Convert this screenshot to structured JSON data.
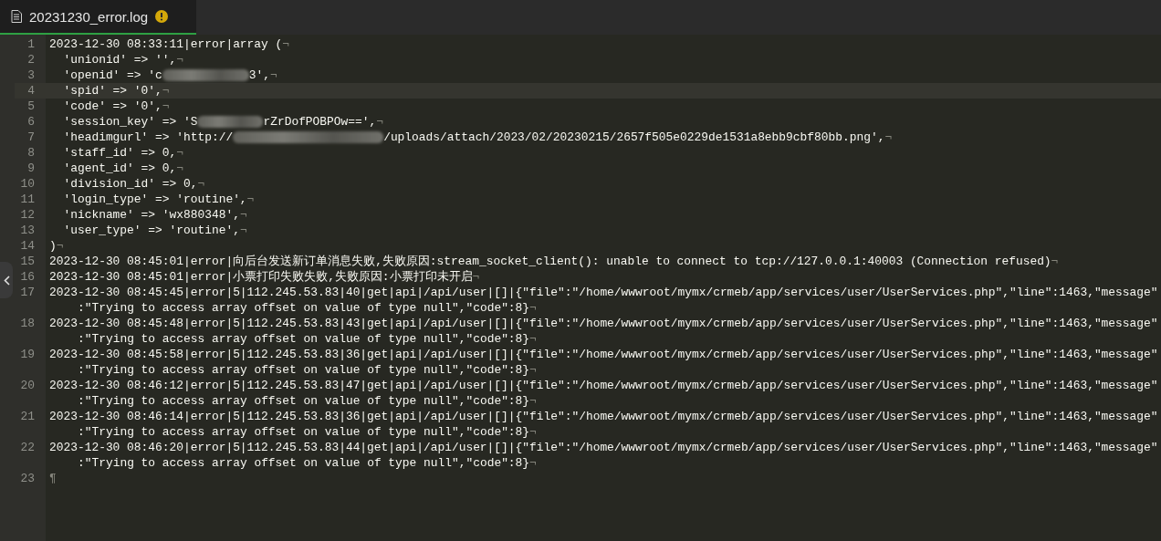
{
  "tabs": [
    {
      "label": "20231230_error.log",
      "selected": true,
      "warning": true
    }
  ],
  "editor": {
    "lines": [
      {
        "number": "1",
        "current": false,
        "segments": [
          {
            "kind": "text",
            "text": "2023-12-30 08:33:11|error|array ("
          }
        ],
        "eol": "¬"
      },
      {
        "number": "2",
        "current": false,
        "segments": [
          {
            "kind": "text",
            "text": "  'unionid' => '',"
          }
        ],
        "eol": "¬"
      },
      {
        "number": "3",
        "current": false,
        "segments": [
          {
            "kind": "text",
            "text": "  'openid' => 'c"
          },
          {
            "kind": "blur"
          },
          {
            "kind": "text",
            "text": "3',"
          }
        ],
        "eol": "¬"
      },
      {
        "number": "4",
        "current": true,
        "segments": [
          {
            "kind": "text",
            "text": "  'spid' => '0',"
          }
        ],
        "eol": "¬"
      },
      {
        "number": "5",
        "current": false,
        "segments": [
          {
            "kind": "text",
            "text": "  'code' => '0',"
          }
        ],
        "eol": "¬"
      },
      {
        "number": "6",
        "current": false,
        "segments": [
          {
            "kind": "text",
            "text": "  'session_key' => 'S"
          },
          {
            "kind": "blur"
          },
          {
            "kind": "text",
            "text": "rZrDofPOBPOw==',"
          }
        ],
        "eol": "¬"
      },
      {
        "number": "7",
        "current": false,
        "segments": [
          {
            "kind": "text",
            "text": "  'headimgurl' => 'http://"
          },
          {
            "kind": "blur"
          },
          {
            "kind": "text",
            "text": "/uploads/attach/2023/02/20230215/2657f505e0229de1531a8ebb9cbf80bb.png',"
          }
        ],
        "eol": "¬"
      },
      {
        "number": "8",
        "current": false,
        "segments": [
          {
            "kind": "text",
            "text": "  'staff_id' => 0,"
          }
        ],
        "eol": "¬"
      },
      {
        "number": "9",
        "current": false,
        "segments": [
          {
            "kind": "text",
            "text": "  'agent_id' => 0,"
          }
        ],
        "eol": "¬"
      },
      {
        "number": "10",
        "current": false,
        "segments": [
          {
            "kind": "text",
            "text": "  'division_id' => 0,"
          }
        ],
        "eol": "¬"
      },
      {
        "number": "11",
        "current": false,
        "segments": [
          {
            "kind": "text",
            "text": "  'login_type' => 'routine',"
          }
        ],
        "eol": "¬"
      },
      {
        "number": "12",
        "current": false,
        "segments": [
          {
            "kind": "text",
            "text": "  'nickname' => 'wx880348',"
          }
        ],
        "eol": "¬"
      },
      {
        "number": "13",
        "current": false,
        "segments": [
          {
            "kind": "text",
            "text": "  'user_type' => 'routine',"
          }
        ],
        "eol": "¬"
      },
      {
        "number": "14",
        "current": false,
        "segments": [
          {
            "kind": "text",
            "text": ")"
          }
        ],
        "eol": "¬"
      },
      {
        "number": "15",
        "current": false,
        "segments": [
          {
            "kind": "text",
            "text": "2023-12-30 08:45:01|error|向后台发送新订单消息失败,失败原因:stream_socket_client(): unable to connect to tcp://127.0.0.1:40003 (Connection refused)"
          }
        ],
        "eol": "¬"
      },
      {
        "number": "16",
        "current": false,
        "segments": [
          {
            "kind": "text",
            "text": "2023-12-30 08:45:01|error|小票打印失败失败,失败原因:小票打印未开启"
          }
        ],
        "eol": "¬"
      },
      {
        "number": "17",
        "current": false,
        "segments": [
          {
            "kind": "text",
            "text": "2023-12-30 08:45:45|error|5|112.245.53.83|40|get|api|/api/user|[]|{\"file\":\"/home/wwwroot/mymx/crmeb/app/services/user/UserServices.php\",\"line\":1463,\"message\""
          }
        ],
        "continuation": ":\"Trying to access array offset on value of type null\",\"code\":8}",
        "eol": "¬"
      },
      {
        "number": "18",
        "current": false,
        "segments": [
          {
            "kind": "text",
            "text": "2023-12-30 08:45:48|error|5|112.245.53.83|43|get|api|/api/user|[]|{\"file\":\"/home/wwwroot/mymx/crmeb/app/services/user/UserServices.php\",\"line\":1463,\"message\""
          }
        ],
        "continuation": ":\"Trying to access array offset on value of type null\",\"code\":8}",
        "eol": "¬"
      },
      {
        "number": "19",
        "current": false,
        "segments": [
          {
            "kind": "text",
            "text": "2023-12-30 08:45:58|error|5|112.245.53.83|36|get|api|/api/user|[]|{\"file\":\"/home/wwwroot/mymx/crmeb/app/services/user/UserServices.php\",\"line\":1463,\"message\""
          }
        ],
        "continuation": ":\"Trying to access array offset on value of type null\",\"code\":8}",
        "eol": "¬"
      },
      {
        "number": "20",
        "current": false,
        "segments": [
          {
            "kind": "text",
            "text": "2023-12-30 08:46:12|error|5|112.245.53.83|47|get|api|/api/user|[]|{\"file\":\"/home/wwwroot/mymx/crmeb/app/services/user/UserServices.php\",\"line\":1463,\"message\""
          }
        ],
        "continuation": ":\"Trying to access array offset on value of type null\",\"code\":8}",
        "eol": "¬"
      },
      {
        "number": "21",
        "current": false,
        "segments": [
          {
            "kind": "text",
            "text": "2023-12-30 08:46:14|error|5|112.245.53.83|36|get|api|/api/user|[]|{\"file\":\"/home/wwwroot/mymx/crmeb/app/services/user/UserServices.php\",\"line\":1463,\"message\""
          }
        ],
        "continuation": ":\"Trying to access array offset on value of type null\",\"code\":8}",
        "eol": "¬"
      },
      {
        "number": "22",
        "current": false,
        "segments": [
          {
            "kind": "text",
            "text": "2023-12-30 08:46:20|error|5|112.245.53.83|44|get|api|/api/user|[]|{\"file\":\"/home/wwwroot/mymx/crmeb/app/services/user/UserServices.php\",\"line\":1463,\"message\""
          }
        ],
        "continuation": ":\"Trying to access array offset on value of type null\",\"code\":8}",
        "eol": "¬"
      },
      {
        "number": "23",
        "current": false,
        "eol": "¶"
      }
    ]
  }
}
